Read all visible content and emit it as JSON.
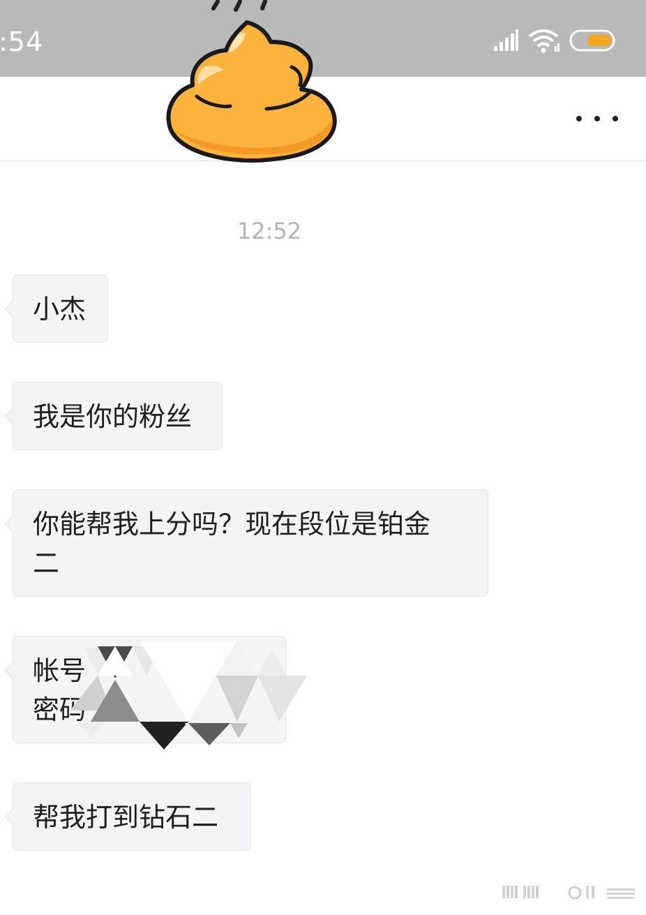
{
  "status_bar": {
    "time": ":54",
    "icons": [
      "signal-icon",
      "wifi-icon",
      "battery-icon"
    ],
    "battery_color": "#f5a623"
  },
  "header": {
    "more_icon": "more-dots-icon",
    "avatar_emoji": "poop-emoji-icon"
  },
  "chat": {
    "timestamp": "12:52",
    "messages": [
      {
        "text": "小杰"
      },
      {
        "text": "我是你的粉丝"
      },
      {
        "line1": "你能帮我上分吗？现在段位是铂金",
        "line2": "二"
      },
      {
        "line1": "帐号",
        "line2": "密码",
        "redacted": true
      },
      {
        "text": "帮我打到钻石二"
      }
    ]
  },
  "colors": {
    "status_bar_bg": "#b9b9b9",
    "bubble_bg": "#f3f4f6",
    "emoji_yellow": "#fbb33c"
  }
}
